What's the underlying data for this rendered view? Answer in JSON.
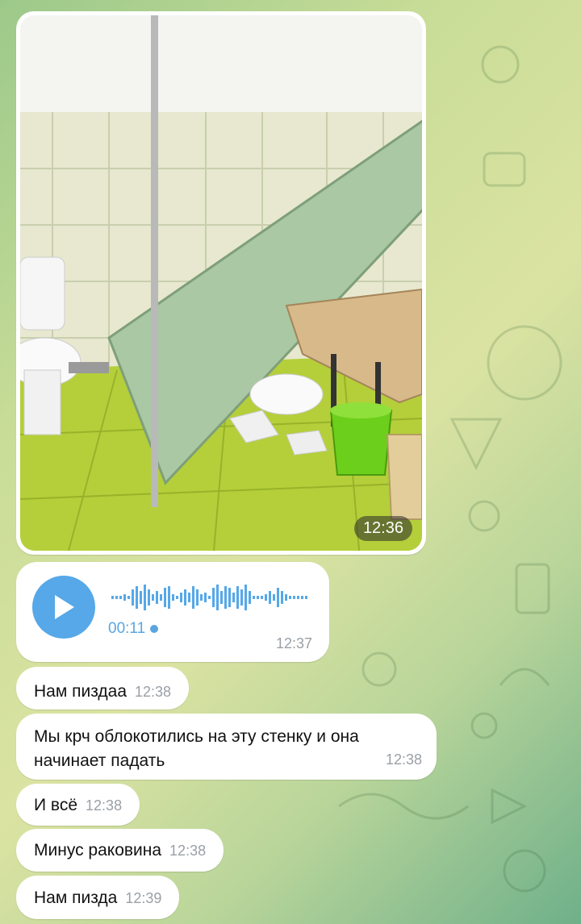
{
  "photo_message": {
    "time": "12:36",
    "image_name": "collapsed-partition-photo"
  },
  "voice_message": {
    "duration": "00:11",
    "time": "12:37"
  },
  "messages": [
    {
      "text": "Нам пиздаа",
      "time": "12:38"
    },
    {
      "text": "Мы крч облокотились на эту стенку и она начинает падать",
      "time": "12:38"
    },
    {
      "text": "И всё",
      "time": "12:38"
    },
    {
      "text": "Минус раковина",
      "time": "12:38"
    },
    {
      "text": "Нам пизда",
      "time": "12:39"
    }
  ],
  "colors": {
    "accent": "#56a8e8",
    "bubble": "#ffffff",
    "time_gray": "#9aa0a6"
  }
}
